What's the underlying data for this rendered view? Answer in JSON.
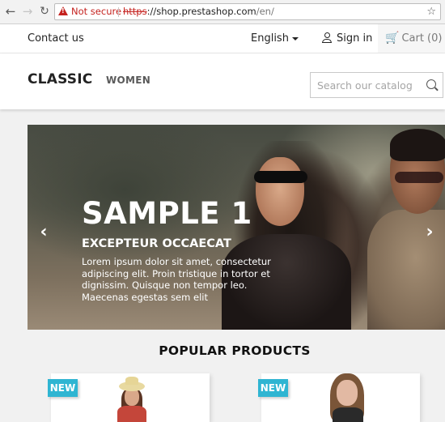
{
  "browser": {
    "security_label": "Not secure",
    "url_scheme": "https",
    "url_host": "://shop.prestashop.com",
    "url_path": "/en/",
    "icons": {
      "back": "arrow-left-icon",
      "forward": "arrow-right-icon",
      "reload": "reload-icon",
      "warning": "warning-triangle-icon",
      "bookmark": "star-icon"
    }
  },
  "topnav": {
    "contact": "Contact us",
    "language": "English",
    "signin": "Sign in",
    "cart": "Cart (0)"
  },
  "header": {
    "logo": "CLASSIC",
    "menu": [
      {
        "label": "WOMEN"
      }
    ],
    "search_placeholder": "Search our catalog"
  },
  "slider": {
    "title": "SAMPLE 1",
    "subtitle": "EXCEPTEUR OCCAECAT",
    "text": "Lorem ipsum dolor sit amet, consectetur adipiscing elit. Proin tristique in tortor et dignissim. Quisque non tempor leo. Maecenas egestas sem elit",
    "prev": "‹",
    "next": "›"
  },
  "popular": {
    "title": "POPULAR PRODUCTS",
    "products": [
      {
        "badge": "NEW"
      },
      {
        "badge": "NEW"
      }
    ]
  },
  "colors": {
    "accent": "#2fb5d2",
    "warning": "#c5221f"
  }
}
